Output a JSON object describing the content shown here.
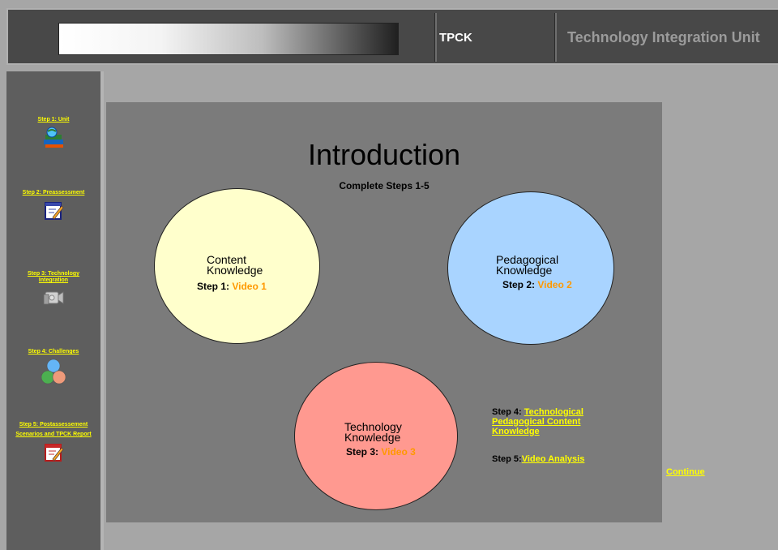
{
  "header": {
    "short_title": "TPCK",
    "title": "Technology Integration Unit"
  },
  "sidebar": {
    "items": [
      {
        "label": "Step 1: Unit",
        "icon": "books-icon"
      },
      {
        "label": "Step 2: Preassessment",
        "icon": "clipboard-pencil-icon"
      },
      {
        "label": "Step 3: Technology Integration",
        "icon": "camcorder-icon"
      },
      {
        "label": "Step 4: Challenges",
        "icon": "venn-circles-icon"
      },
      {
        "label": "Step 5: Postassessement",
        "label2": "Scenarios and TPCK Report",
        "icon": "clipboard-pencil-icon"
      }
    ]
  },
  "main": {
    "title": "Introduction",
    "subtitle": "Complete Steps 1-5",
    "circles": {
      "content": {
        "line1": "Content",
        "line2": "Knowledge",
        "step": "Step 1:",
        "video": "Video 1",
        "color": "#ffffcc"
      },
      "pedagogical": {
        "line1": "Pedagogical",
        "line2": "Knowledge",
        "step": "Step 2:",
        "video": "Video 2",
        "color": "#a9d4ff"
      },
      "technology": {
        "line1": "Technology",
        "line2": "Knowledge",
        "step": "Step 3:",
        "video": "Video 3",
        "color": "#ff9990"
      }
    },
    "step4": {
      "prefix": "Step 4:",
      "link": "Technological Pedagogical Content Knowledge"
    },
    "step5": {
      "prefix": "Step 5:",
      "link": "Video Analysis"
    },
    "continue": "Continue"
  },
  "colors": {
    "link": "#ffff00",
    "video_link": "#ff9900",
    "panel": "#7b7b7b",
    "sidebar": "#5e5e5e"
  }
}
